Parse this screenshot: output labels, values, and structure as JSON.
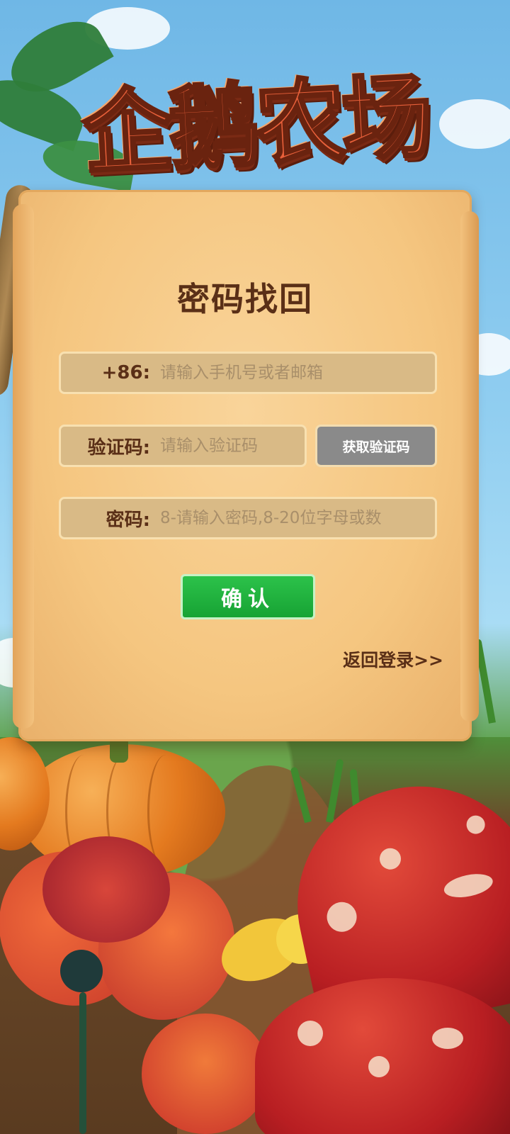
{
  "app": {
    "logo_text": "企鹅农场"
  },
  "form": {
    "title": "密码找回",
    "phone": {
      "label": "+86:",
      "placeholder": "请输入手机号或者邮箱",
      "value": ""
    },
    "code": {
      "label": "验证码:",
      "placeholder": "请输入验证码",
      "value": "",
      "get_code_label": "获取验证码"
    },
    "password": {
      "label": "密码:",
      "placeholder": "8-请输入密码,8-20位字母或数",
      "value": ""
    },
    "confirm_label": "确认",
    "back_login_label": "返回登录>>"
  },
  "colors": {
    "parchment": "#f5c680",
    "title_text": "#5a2f17",
    "confirm_green": "#1fae3e",
    "code_button_gray": "#8a8a8a",
    "logo_orange": "#e8603a"
  },
  "icons": {
    "background": "farm-scenery-illustration"
  }
}
